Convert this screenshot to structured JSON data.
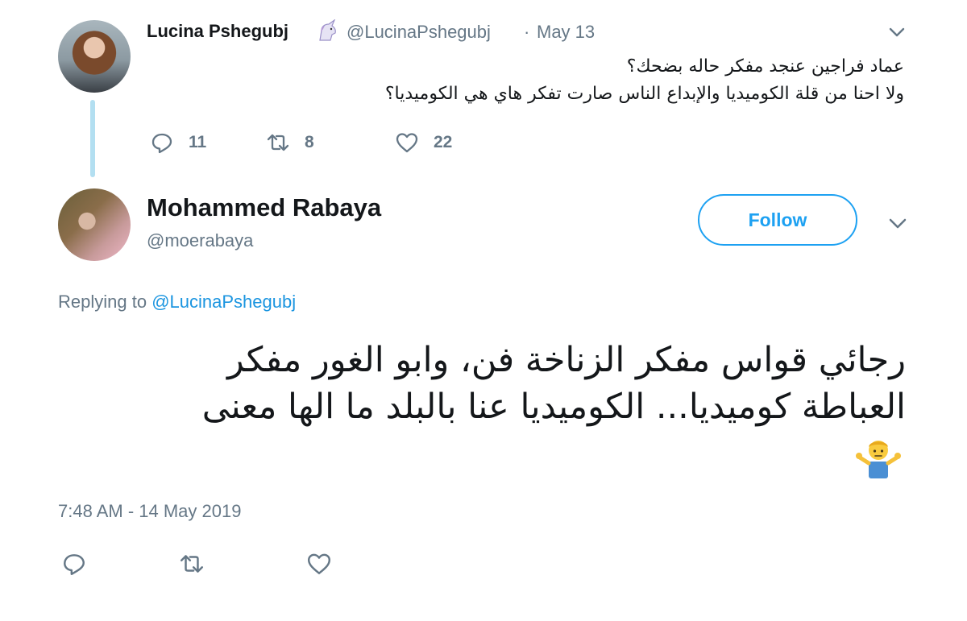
{
  "colors": {
    "text": "#14171a",
    "muted": "#657786",
    "link": "#1b95e0",
    "accent": "#1da1f2",
    "thread_line": "#b3dff1"
  },
  "parent_tweet": {
    "name": "Lucina Pshegubj",
    "name_emoji": "unicorn-emoji",
    "handle": "@LucinaPshegubj",
    "separator": "·",
    "date": "May 13",
    "lines": [
      "عماد فراجين عنجد مفكر حاله بضحك؟",
      "ولا احنا من قلة الكوميديا والإبداع الناس صارت تفكر هاي هي الكوميديا؟"
    ],
    "actions": {
      "reply_icon": "reply-icon",
      "reply_count": "11",
      "retweet_icon": "retweet-icon",
      "retweet_count": "8",
      "like_icon": "heart-icon",
      "like_count": "22"
    },
    "menu_icon": "chevron-down-icon"
  },
  "main_tweet": {
    "name": "Mohammed Rabaya",
    "handle": "@moerabaya",
    "follow_label": "Follow",
    "menu_icon": "chevron-down-icon",
    "replying_prefix": "Replying to",
    "replying_mention": "@LucinaPshegubj",
    "lines": [
      "رجائي قواس مفكر الزناخة فن، وابو الغور مفكر",
      "العباطة كوميديا... الكوميديا عنا بالبلد ما الها معنى"
    ],
    "emoji": "man-shrugging-emoji",
    "timestamp": "7:48 AM - 14 May 2019",
    "actions": {
      "reply_icon": "reply-icon",
      "retweet_icon": "retweet-icon",
      "like_icon": "heart-icon"
    }
  }
}
